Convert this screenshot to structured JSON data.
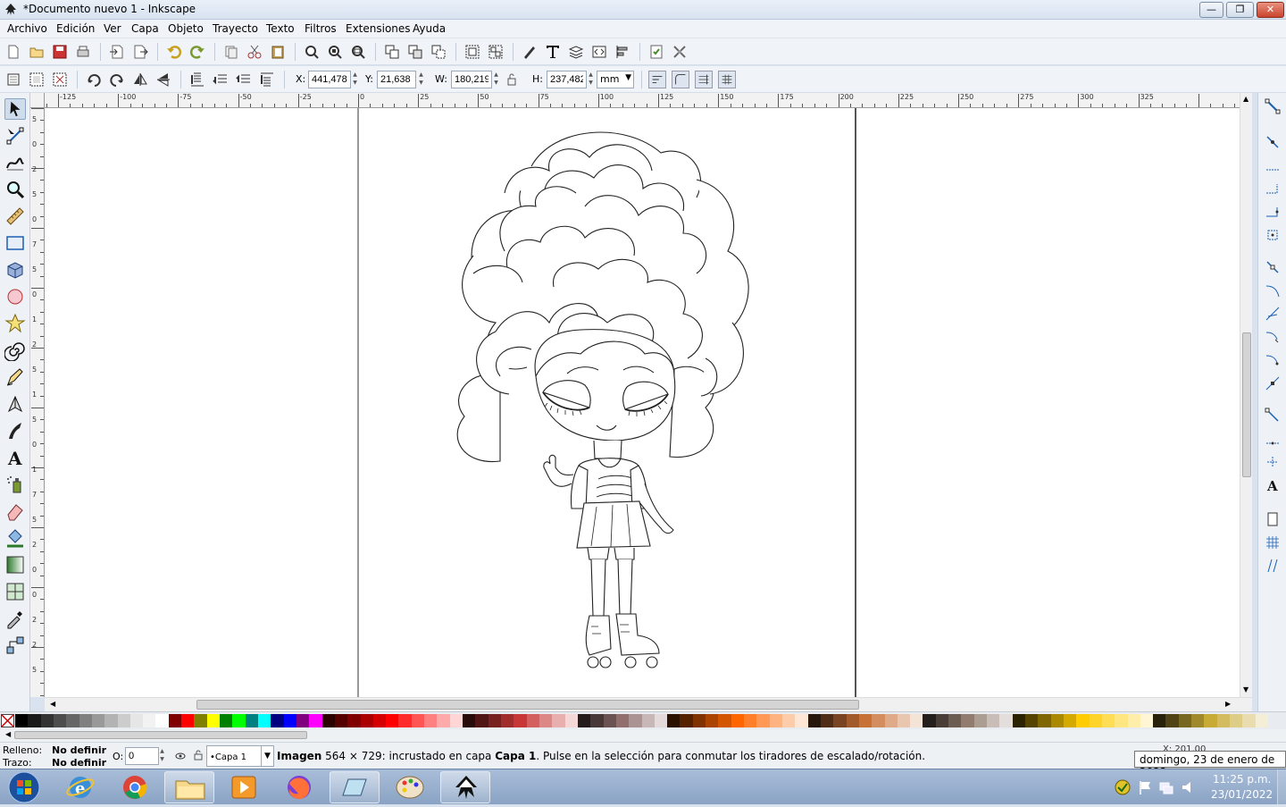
{
  "window": {
    "title": "*Documento nuevo 1 - Inkscape",
    "controls": {
      "minimize": "—",
      "maximize": "❐",
      "close": "✕"
    }
  },
  "menubar": [
    "Archivo",
    "Edición",
    "Ver",
    "Capa",
    "Objeto",
    "Trayecto",
    "Texto",
    "Filtros",
    "Extensiones",
    "Ayuda"
  ],
  "selector_toolbar": {
    "x_label": "X:",
    "x_value": "441,478",
    "y_label": "Y:",
    "y_value": "21,638",
    "w_label": "W:",
    "w_value": "180,219",
    "h_label": "H:",
    "h_value": "237,482",
    "unit": "mm"
  },
  "ruler": {
    "top_labels": [
      "-125",
      "-100",
      "-75",
      "-50",
      "-25",
      "0",
      "25",
      "50",
      "75",
      "100",
      "125",
      "150",
      "175",
      "200",
      "225",
      "250",
      "275",
      "300",
      "325"
    ],
    "left_labels": [
      "5",
      "0",
      "2",
      "5",
      "0",
      "7",
      "5",
      "0",
      "1",
      "2",
      "5",
      "1",
      "5",
      "0",
      "1",
      "7",
      "5",
      "2",
      "0",
      "0",
      "2",
      "2",
      "5"
    ]
  },
  "status": {
    "fill_label": "Relleno:",
    "fill_value": "No definir",
    "stroke_label": "Trazo:",
    "stroke_value": "No definir",
    "opacity_label": "O:",
    "opacity_value": "0",
    "layer": "•Capa 1",
    "message_bold": "Imagen",
    "message_dims": " 564 × 729: incrustado en capa ",
    "message_layer": "Capa 1",
    "message_tail": ". Pulse en la selección para conmutar los tiradores de escalado/rotación.",
    "cursor_x": "X: 201,00"
  },
  "taskbar": {
    "time": "11:25 p.m.",
    "date": "23/01/2022",
    "tooltip": "domingo, 23 de enero de 2022"
  },
  "palette_colors": [
    "#000000",
    "#1a1a1a",
    "#333333",
    "#4d4d4d",
    "#666666",
    "#808080",
    "#999999",
    "#b3b3b3",
    "#cccccc",
    "#e6e6e6",
    "#f2f2f2",
    "#ffffff",
    "#800000",
    "#ff0000",
    "#808000",
    "#ffff00",
    "#008000",
    "#00ff00",
    "#008080",
    "#00ffff",
    "#000080",
    "#0000ff",
    "#800080",
    "#ff00ff",
    "#2b0000",
    "#550000",
    "#800000",
    "#aa0000",
    "#d40000",
    "#ff0000",
    "#ff2a2a",
    "#ff5555",
    "#ff8080",
    "#ffaaaa",
    "#ffd5d5",
    "#280b0b",
    "#501616",
    "#782121",
    "#a02c2c",
    "#c83737",
    "#d35f5f",
    "#de8787",
    "#e9afaf",
    "#f4d7d7",
    "#241c1c",
    "#483737",
    "#6c5353",
    "#916f6f",
    "#ac9393",
    "#c8b7b7",
    "#e3dbdb",
    "#2b1100",
    "#552200",
    "#803300",
    "#aa4400",
    "#d45500",
    "#ff6600",
    "#ff7f2a",
    "#ff9955",
    "#ffb380",
    "#ffccaa",
    "#ffe6d5",
    "#28170b",
    "#502d16",
    "#784421",
    "#a05a2c",
    "#c87137",
    "#d38d5f",
    "#deaa87",
    "#e9c6af",
    "#f4e3d7",
    "#241f1c",
    "#483e37",
    "#6c5d53",
    "#917c6f",
    "#ac9d93",
    "#c8beb7",
    "#e3dedb",
    "#2b2200",
    "#554400",
    "#806600",
    "#aa8800",
    "#d4aa00",
    "#ffcc00",
    "#ffd42a",
    "#ffdd55",
    "#ffe680",
    "#ffeeaa",
    "#fff6d5",
    "#28220b",
    "#504416",
    "#786721",
    "#a0892c",
    "#c8ab37",
    "#d3bc5f",
    "#decd87",
    "#e9ddaf",
    "#f4eed7"
  ]
}
